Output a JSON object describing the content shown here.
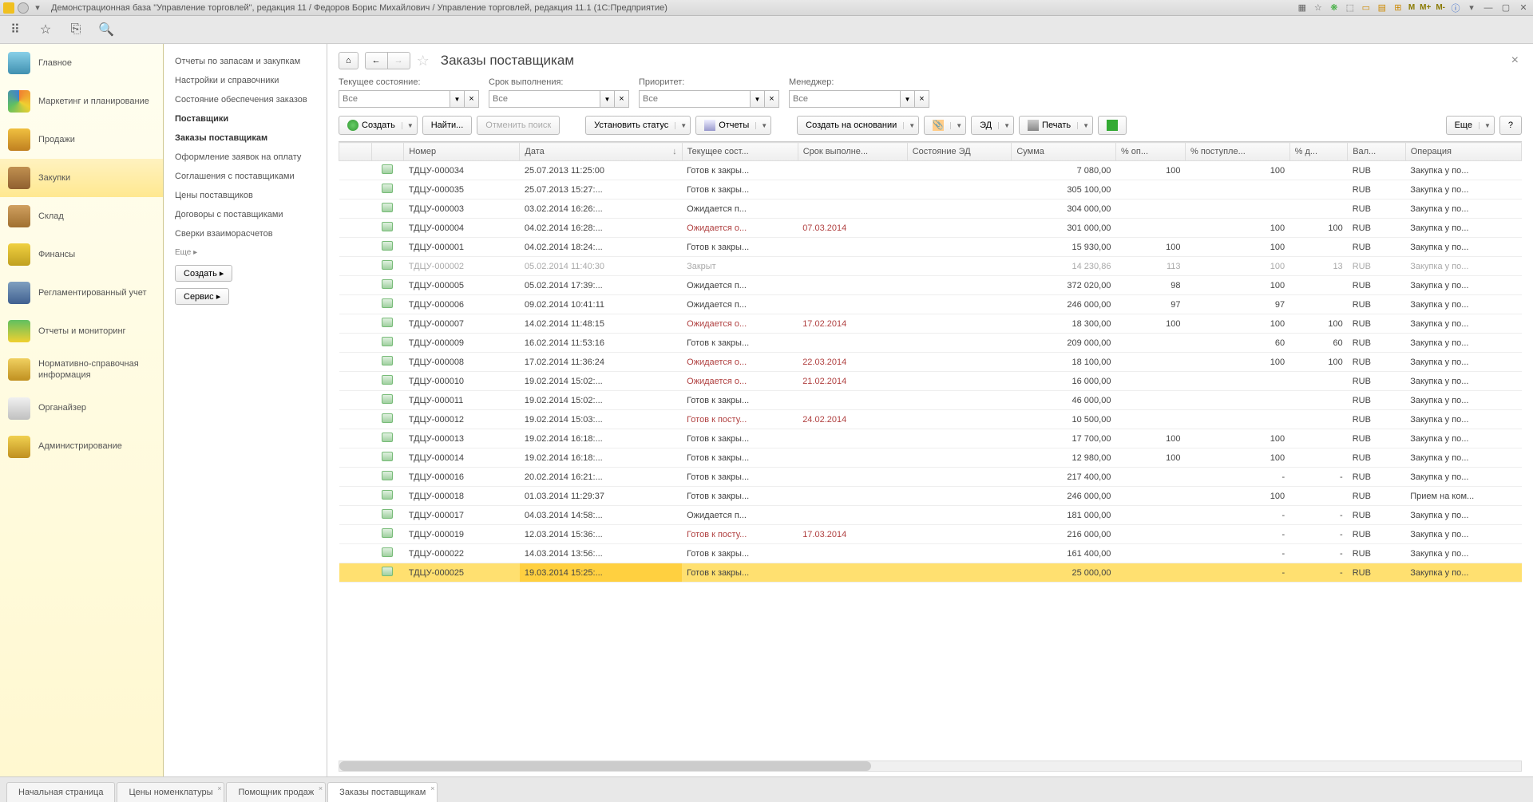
{
  "titlebar": {
    "title": "Демонстрационная база \"Управление торговлей\", редакция 11 / Федоров Борис Михайлович / Управление торговлей, редакция 11.1  (1С:Предприятие)",
    "m_labels": [
      "M",
      "M+",
      "M-"
    ]
  },
  "nav": {
    "items": [
      {
        "label": "Главное",
        "ico": "ico-home"
      },
      {
        "label": "Маркетинг и планирование",
        "ico": "ico-marketing"
      },
      {
        "label": "Продажи",
        "ico": "ico-sales"
      },
      {
        "label": "Закупки",
        "ico": "ico-purchase",
        "active": true
      },
      {
        "label": "Склад",
        "ico": "ico-warehouse"
      },
      {
        "label": "Финансы",
        "ico": "ico-finance"
      },
      {
        "label": "Регламентированный учет",
        "ico": "ico-reg"
      },
      {
        "label": "Отчеты и мониторинг",
        "ico": "ico-reports"
      },
      {
        "label": "Нормативно-справочная информация",
        "ico": "ico-norm"
      },
      {
        "label": "Органайзер",
        "ico": "ico-org"
      },
      {
        "label": "Администрирование",
        "ico": "ico-admin"
      }
    ]
  },
  "subnav": {
    "items": [
      {
        "label": "Отчеты по запасам и закупкам"
      },
      {
        "label": "Настройки и справочники"
      },
      {
        "label": "Состояние обеспечения заказов"
      },
      {
        "label": "Поставщики",
        "bold": true
      },
      {
        "label": "Заказы поставщикам",
        "bold": true
      },
      {
        "label": "Оформление заявок на оплату"
      },
      {
        "label": "Соглашения с поставщиками"
      },
      {
        "label": "Цены поставщиков"
      },
      {
        "label": "Договоры с поставщиками"
      },
      {
        "label": "Сверки взаиморасчетов"
      }
    ],
    "more": "Еще ▸",
    "create": "Создать ▸",
    "service": "Сервис ▸"
  },
  "page": {
    "title": "Заказы поставщикам"
  },
  "filters": {
    "f1": {
      "label": "Текущее состояние:",
      "placeholder": "Все"
    },
    "f2": {
      "label": "Срок выполнения:",
      "placeholder": "Все"
    },
    "f3": {
      "label": "Приоритет:",
      "placeholder": "Все"
    },
    "f4": {
      "label": "Менеджер:",
      "placeholder": "Все"
    }
  },
  "toolbar2": {
    "create": "Создать",
    "find": "Найти...",
    "cancel": "Отменить поиск",
    "status": "Установить статус",
    "reports": "Отчеты",
    "basedon": "Создать на основании",
    "ed": "ЭД",
    "print": "Печать",
    "more": "Еще",
    "help": "?"
  },
  "columns": [
    "",
    "",
    "Номер",
    "Дата",
    "Текущее сост...",
    "Срок выполне...",
    "Состояние ЭД",
    "Сумма",
    "% оп...",
    "% поступле...",
    "% д...",
    "Вал...",
    "Операция"
  ],
  "rows": [
    {
      "num": "ТДЦУ-000034",
      "date": "25.07.2013 11:25:00",
      "state": "Готов к закры...",
      "due": "",
      "ed": "",
      "sum": "7 080,00",
      "op": "100",
      "post": "100",
      "d": "",
      "cur": "RUB",
      "oper": "Закупка у по..."
    },
    {
      "num": "ТДЦУ-000035",
      "date": "25.07.2013 15:27:...",
      "state": "Готов к закры...",
      "due": "",
      "ed": "",
      "sum": "305 100,00",
      "op": "",
      "post": "",
      "d": "",
      "cur": "RUB",
      "oper": "Закупка у по..."
    },
    {
      "num": "ТДЦУ-000003",
      "date": "03.02.2014 16:26:...",
      "state": "Ожидается п...",
      "due": "",
      "ed": "",
      "sum": "304 000,00",
      "op": "",
      "post": "",
      "d": "",
      "cur": "RUB",
      "oper": "Закупка у по..."
    },
    {
      "num": "ТДЦУ-000004",
      "date": "04.02.2014 16:28:...",
      "state": "Ожидается о...",
      "state_red": true,
      "due": "07.03.2014",
      "due_red": true,
      "ed": "",
      "sum": "301 000,00",
      "op": "",
      "post": "100",
      "d": "100",
      "cur": "RUB",
      "oper": "Закупка у по..."
    },
    {
      "num": "ТДЦУ-000001",
      "date": "04.02.2014 18:24:...",
      "state": "Готов к закры...",
      "due": "",
      "ed": "",
      "sum": "15 930,00",
      "op": "100",
      "post": "100",
      "d": "",
      "cur": "RUB",
      "oper": "Закупка у по..."
    },
    {
      "num": "ТДЦУ-000002",
      "date": "05.02.2014 11:40:30",
      "state": "Закрыт",
      "due": "",
      "ed": "",
      "sum": "14 230,86",
      "op": "113",
      "post": "100",
      "d": "13",
      "cur": "RUB",
      "oper": "Закупка у по...",
      "closed": true
    },
    {
      "num": "ТДЦУ-000005",
      "date": "05.02.2014 17:39:...",
      "state": "Ожидается п...",
      "due": "",
      "ed": "",
      "sum": "372 020,00",
      "op": "98",
      "post": "100",
      "d": "",
      "cur": "RUB",
      "oper": "Закупка у по..."
    },
    {
      "num": "ТДЦУ-000006",
      "date": "09.02.2014 10:41:11",
      "state": "Ожидается п...",
      "due": "",
      "ed": "",
      "sum": "246 000,00",
      "op": "97",
      "post": "97",
      "d": "",
      "cur": "RUB",
      "oper": "Закупка у по..."
    },
    {
      "num": "ТДЦУ-000007",
      "date": "14.02.2014 11:48:15",
      "state": "Ожидается о...",
      "state_red": true,
      "due": "17.02.2014",
      "due_red": true,
      "ed": "",
      "sum": "18 300,00",
      "op": "100",
      "post": "100",
      "d": "100",
      "cur": "RUB",
      "oper": "Закупка у по..."
    },
    {
      "num": "ТДЦУ-000009",
      "date": "16.02.2014 11:53:16",
      "state": "Готов к закры...",
      "due": "",
      "ed": "",
      "sum": "209 000,00",
      "op": "",
      "post": "60",
      "d": "60",
      "cur": "RUB",
      "oper": "Закупка у по..."
    },
    {
      "num": "ТДЦУ-000008",
      "date": "17.02.2014 11:36:24",
      "state": "Ожидается о...",
      "state_red": true,
      "due": "22.03.2014",
      "due_red": true,
      "ed": "",
      "sum": "18 100,00",
      "op": "",
      "post": "100",
      "d": "100",
      "cur": "RUB",
      "oper": "Закупка у по..."
    },
    {
      "num": "ТДЦУ-000010",
      "date": "19.02.2014 15:02:...",
      "state": "Ожидается о...",
      "state_red": true,
      "due": "21.02.2014",
      "due_red": true,
      "ed": "",
      "sum": "16 000,00",
      "op": "",
      "post": "",
      "d": "",
      "cur": "RUB",
      "oper": "Закупка у по..."
    },
    {
      "num": "ТДЦУ-000011",
      "date": "19.02.2014 15:02:...",
      "state": "Готов к закры...",
      "due": "",
      "ed": "",
      "sum": "46 000,00",
      "op": "",
      "post": "",
      "d": "",
      "cur": "RUB",
      "oper": "Закупка у по..."
    },
    {
      "num": "ТДЦУ-000012",
      "date": "19.02.2014 15:03:...",
      "state": "Готов к посту...",
      "state_red": true,
      "due": "24.02.2014",
      "due_red": true,
      "ed": "",
      "sum": "10 500,00",
      "op": "",
      "post": "",
      "d": "",
      "cur": "RUB",
      "oper": "Закупка у по..."
    },
    {
      "num": "ТДЦУ-000013",
      "date": "19.02.2014 16:18:...",
      "state": "Готов к закры...",
      "due": "",
      "ed": "",
      "sum": "17 700,00",
      "op": "100",
      "post": "100",
      "d": "",
      "cur": "RUB",
      "oper": "Закупка у по..."
    },
    {
      "num": "ТДЦУ-000014",
      "date": "19.02.2014 16:18:...",
      "state": "Готов к закры...",
      "due": "",
      "ed": "",
      "sum": "12 980,00",
      "op": "100",
      "post": "100",
      "d": "",
      "cur": "RUB",
      "oper": "Закупка у по..."
    },
    {
      "num": "ТДЦУ-000016",
      "date": "20.02.2014 16:21:...",
      "state": "Готов к закры...",
      "due": "",
      "ed": "",
      "sum": "217 400,00",
      "op": "",
      "post": "-",
      "d": "-",
      "cur": "RUB",
      "oper": "Закупка у по..."
    },
    {
      "num": "ТДЦУ-000018",
      "date": "01.03.2014 11:29:37",
      "state": "Готов к закры...",
      "due": "",
      "ed": "",
      "sum": "246 000,00",
      "op": "",
      "post": "100",
      "d": "",
      "cur": "RUB",
      "oper": "Прием на ком..."
    },
    {
      "num": "ТДЦУ-000017",
      "date": "04.03.2014 14:58:...",
      "state": "Ожидается п...",
      "due": "",
      "ed": "",
      "sum": "181 000,00",
      "op": "",
      "post": "-",
      "d": "-",
      "cur": "RUB",
      "oper": "Закупка у по..."
    },
    {
      "num": "ТДЦУ-000019",
      "date": "12.03.2014 15:36:...",
      "state": "Готов к посту...",
      "state_red": true,
      "due": "17.03.2014",
      "due_red": true,
      "ed": "",
      "sum": "216 000,00",
      "op": "",
      "post": "-",
      "d": "-",
      "cur": "RUB",
      "oper": "Закупка у по..."
    },
    {
      "num": "ТДЦУ-000022",
      "date": "14.03.2014 13:56:...",
      "state": "Готов к закры...",
      "due": "",
      "ed": "",
      "sum": "161 400,00",
      "op": "",
      "post": "-",
      "d": "-",
      "cur": "RUB",
      "oper": "Закупка у по..."
    },
    {
      "num": "ТДЦУ-000025",
      "date": "19.03.2014 15:25:...",
      "state": "Готов к закры...",
      "due": "",
      "ed": "",
      "sum": "25 000,00",
      "op": "",
      "post": "-",
      "d": "-",
      "cur": "RUB",
      "oper": "Закупка у по...",
      "selected": true
    }
  ],
  "tabs": [
    {
      "label": "Начальная страница"
    },
    {
      "label": "Цены номенклатуры",
      "x": true
    },
    {
      "label": "Помощник продаж",
      "x": true
    },
    {
      "label": "Заказы поставщикам",
      "x": true,
      "active": true
    }
  ]
}
